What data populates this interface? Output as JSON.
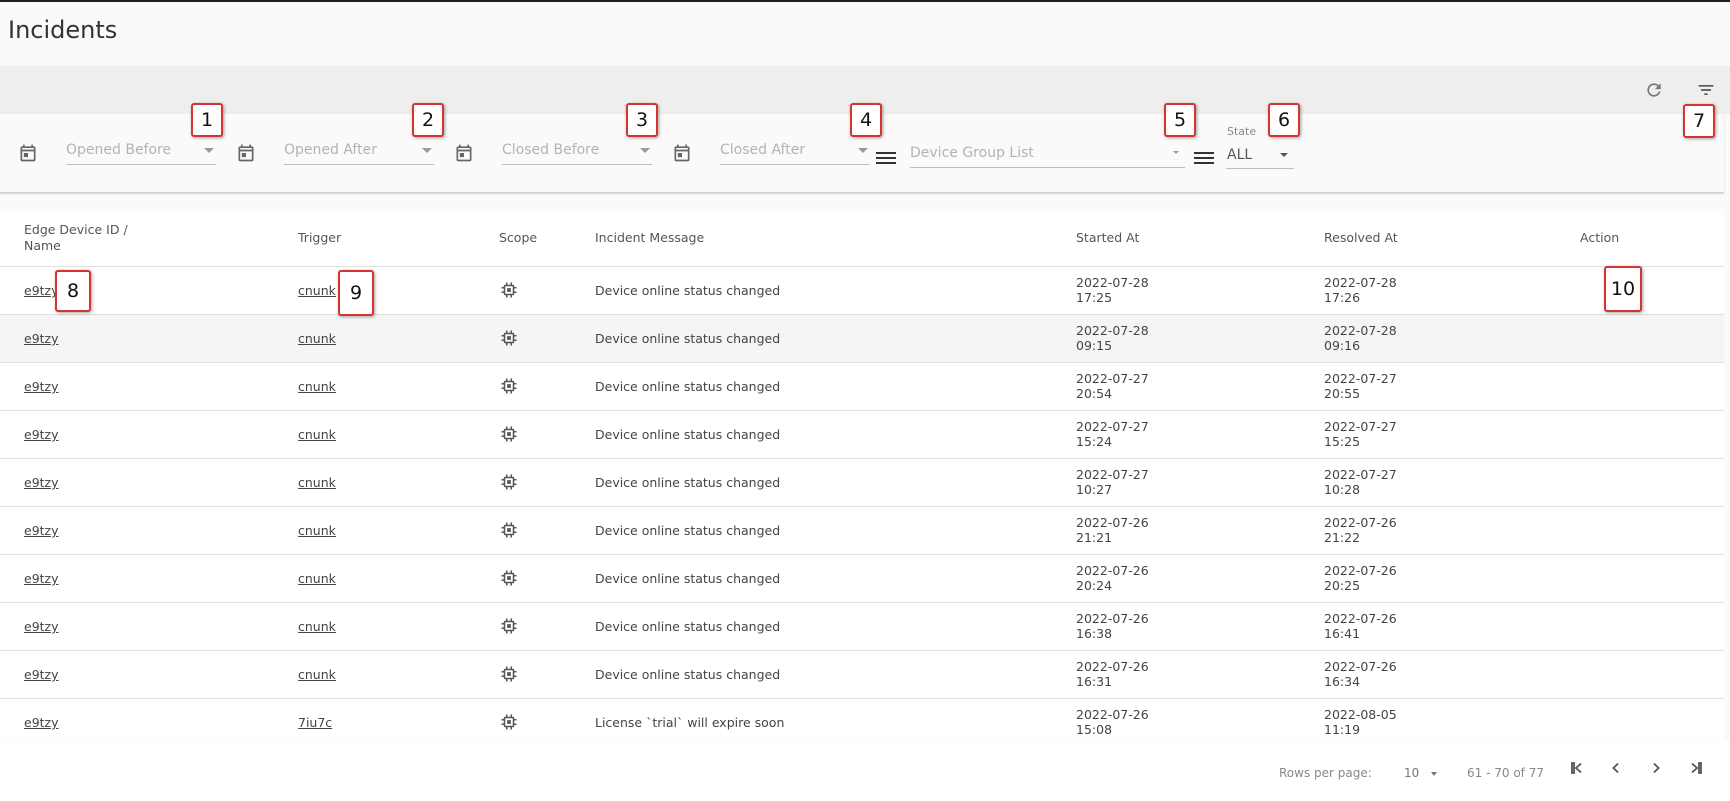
{
  "page": {
    "title": "Incidents"
  },
  "toolbar": {
    "refresh_icon": "refresh-icon",
    "filter_icon": "filter-icon"
  },
  "filters": {
    "opened_before": "Opened Before",
    "opened_after": "Opened After",
    "closed_before": "Closed Before",
    "closed_after": "Closed After",
    "device_group_list": "Device Group List",
    "state_label": "State",
    "state_value": "ALL"
  },
  "markers": [
    "1",
    "2",
    "3",
    "4",
    "5",
    "6",
    "7",
    "8",
    "9",
    "10"
  ],
  "table": {
    "headers": {
      "device_line1": "Edge Device ID /",
      "device_line2": "Name",
      "trigger": "Trigger",
      "scope": "Scope",
      "message": "Incident Message",
      "started": "Started At",
      "resolved": "Resolved At",
      "action": "Action"
    },
    "rows": [
      {
        "device": "e9tzy",
        "trigger": "cnunk",
        "message": "Device online status changed",
        "started_date": "2022-07-28",
        "started_time": "17:25",
        "resolved_date": "2022-07-28",
        "resolved_time": "17:26"
      },
      {
        "device": "e9tzy",
        "trigger": "cnunk",
        "message": "Device online status changed",
        "started_date": "2022-07-28",
        "started_time": "09:15",
        "resolved_date": "2022-07-28",
        "resolved_time": "09:16"
      },
      {
        "device": "e9tzy",
        "trigger": "cnunk",
        "message": "Device online status changed",
        "started_date": "2022-07-27",
        "started_time": "20:54",
        "resolved_date": "2022-07-27",
        "resolved_time": "20:55"
      },
      {
        "device": "e9tzy",
        "trigger": "cnunk",
        "message": "Device online status changed",
        "started_date": "2022-07-27",
        "started_time": "15:24",
        "resolved_date": "2022-07-27",
        "resolved_time": "15:25"
      },
      {
        "device": "e9tzy",
        "trigger": "cnunk",
        "message": "Device online status changed",
        "started_date": "2022-07-27",
        "started_time": "10:27",
        "resolved_date": "2022-07-27",
        "resolved_time": "10:28"
      },
      {
        "device": "e9tzy",
        "trigger": "cnunk",
        "message": "Device online status changed",
        "started_date": "2022-07-26",
        "started_time": "21:21",
        "resolved_date": "2022-07-26",
        "resolved_time": "21:22"
      },
      {
        "device": "e9tzy",
        "trigger": "cnunk",
        "message": "Device online status changed",
        "started_date": "2022-07-26",
        "started_time": "20:24",
        "resolved_date": "2022-07-26",
        "resolved_time": "20:25"
      },
      {
        "device": "e9tzy",
        "trigger": "cnunk",
        "message": "Device online status changed",
        "started_date": "2022-07-26",
        "started_time": "16:38",
        "resolved_date": "2022-07-26",
        "resolved_time": "16:41"
      },
      {
        "device": "e9tzy",
        "trigger": "cnunk",
        "message": "Device online status changed",
        "started_date": "2022-07-26",
        "started_time": "16:31",
        "resolved_date": "2022-07-26",
        "resolved_time": "16:34"
      },
      {
        "device": "e9tzy",
        "trigger": "7iu7c",
        "message": "License `trial` will expire soon",
        "started_date": "2022-07-26",
        "started_time": "15:08",
        "resolved_date": "2022-08-05",
        "resolved_time": "11:19"
      }
    ]
  },
  "pagination": {
    "rows_per_page_label": "Rows per page:",
    "rows_per_page_value": "10",
    "range": "61 - 70 of 77"
  },
  "colors": {
    "marker_border": "#d63333",
    "toolbar_bg": "#eeeeee",
    "alt_row_bg": "#f5f5f5"
  }
}
